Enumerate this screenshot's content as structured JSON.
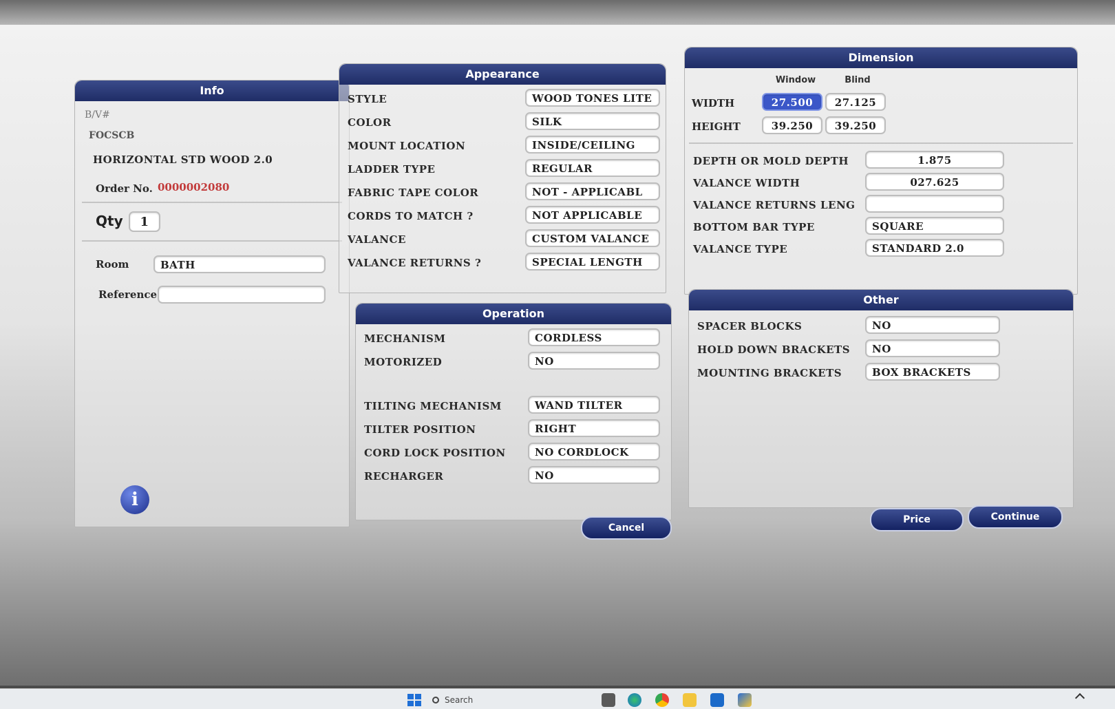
{
  "info": {
    "title": "Info",
    "line1": "B/V#",
    "line2": "FOCSCB",
    "product": "HORIZONTAL STD WOOD 2.0",
    "order_label": "Order No.",
    "order_value": "0000002080",
    "qty_label": "Qty",
    "qty_value": "1",
    "room_label": "Room",
    "room_value": "BATH",
    "reference_label": "Reference",
    "reference_value": ""
  },
  "appearance": {
    "title": "Appearance",
    "rows": [
      {
        "label": "STYLE",
        "value": "WOOD TONES LITE"
      },
      {
        "label": "COLOR",
        "value": "SILK"
      },
      {
        "label": "MOUNT LOCATION",
        "value": "INSIDE/CEILING"
      },
      {
        "label": "LADDER TYPE",
        "value": "REGULAR"
      },
      {
        "label": "FABRIC TAPE COLOR",
        "value": "NOT - APPLICABL"
      },
      {
        "label": "CORDS TO MATCH ?",
        "value": "NOT APPLICABLE"
      },
      {
        "label": "VALANCE",
        "value": "CUSTOM VALANCE"
      },
      {
        "label": "VALANCE RETURNS ?",
        "value": "SPECIAL LENGTH"
      }
    ]
  },
  "operation": {
    "title": "Operation",
    "rows": [
      {
        "label": "MECHANISM",
        "value": "CORDLESS"
      },
      {
        "label": "MOTORIZED",
        "value": "NO"
      },
      {
        "label": "TILTING MECHANISM",
        "value": "WAND TILTER"
      },
      {
        "label": "TILTER POSITION",
        "value": "RIGHT"
      },
      {
        "label": "CORD LOCK POSITION",
        "value": "NO CORDLOCK"
      },
      {
        "label": "RECHARGER",
        "value": "NO"
      }
    ]
  },
  "dimension": {
    "title": "Dimension",
    "col_window": "Window",
    "col_blind": "Blind",
    "width_label": "WIDTH",
    "width_window": "27.500",
    "width_blind": "27.125",
    "height_label": "HEIGHT",
    "height_window": "39.250",
    "height_blind": "39.250",
    "rows": [
      {
        "label": "DEPTH OR MOLD DEPTH",
        "value": "1.875"
      },
      {
        "label": "VALANCE WIDTH",
        "value": "027.625"
      },
      {
        "label": "VALANCE RETURNS LENG",
        "value": ""
      },
      {
        "label": "BOTTOM BAR TYPE",
        "value": "SQUARE"
      },
      {
        "label": "VALANCE TYPE",
        "value": "STANDARD 2.0"
      }
    ]
  },
  "other": {
    "title": "Other",
    "rows": [
      {
        "label": "SPACER BLOCKS",
        "value": "NO"
      },
      {
        "label": "HOLD DOWN BRACKETS",
        "value": "NO"
      },
      {
        "label": "MOUNTING BRACKETS",
        "value": "BOX BRACKETS"
      }
    ]
  },
  "buttons": {
    "cancel": "Cancel",
    "price": "Price",
    "continue": "Continue"
  },
  "taskbar": {
    "search_label": "Search"
  },
  "colors": {
    "header_blue": "#1f2d66",
    "selected_field": "#3b57c8"
  }
}
